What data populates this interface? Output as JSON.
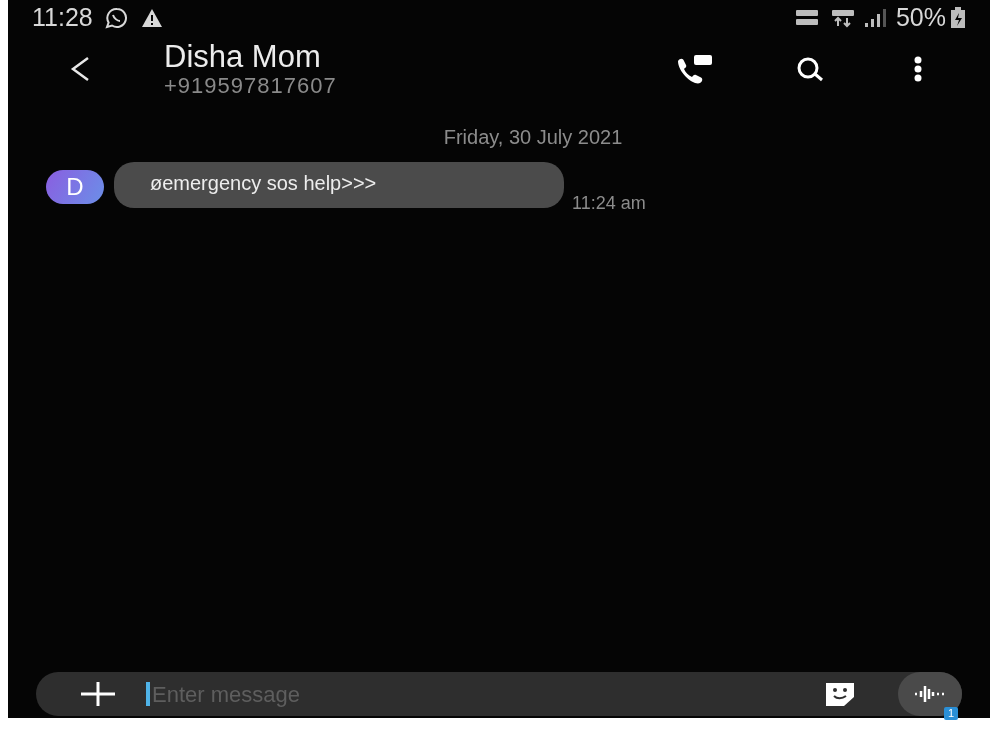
{
  "status_bar": {
    "time": "11:28",
    "battery": "50%"
  },
  "header": {
    "contact_name": "Disha Mom",
    "phone_number": "+919597817607"
  },
  "conversation": {
    "date": "Friday, 30 July 2021",
    "messages": [
      {
        "avatar_letter": "D",
        "text": "øemergency sos help>>>",
        "time": "11:24 am"
      }
    ]
  },
  "composer": {
    "placeholder": "Enter message",
    "sim_badge": "1"
  }
}
